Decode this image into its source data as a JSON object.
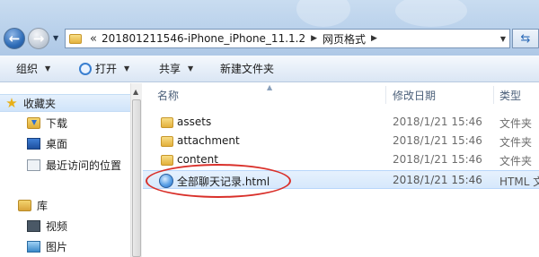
{
  "address_bar": {
    "overflow_marker": "«",
    "segments": [
      "201801211546-iPhone_iPhone_11.1.2",
      "网页格式"
    ]
  },
  "toolbar": {
    "organize_label": "组织",
    "open_label": "打开",
    "share_label": "共享",
    "new_folder_label": "新建文件夹"
  },
  "navigation": {
    "favorites_label": "收藏夹",
    "favorites_items": [
      "下载",
      "桌面",
      "最近访问的位置"
    ],
    "library_label": "库",
    "library_items": [
      "视频",
      "图片"
    ]
  },
  "columns": {
    "name": "名称",
    "date_modified": "修改日期",
    "type": "类型"
  },
  "files": [
    {
      "name": "assets",
      "date": "2018/1/21 15:46",
      "type": "文件夹",
      "icon": "folder-icon"
    },
    {
      "name": "attachment",
      "date": "2018/1/21 15:46",
      "type": "文件夹",
      "icon": "folder-icon"
    },
    {
      "name": "content",
      "date": "2018/1/21 15:46",
      "type": "文件夹",
      "icon": "folder-icon"
    },
    {
      "name": "全部聊天记录.html",
      "date": "2018/1/21 15:46",
      "type": "HTML 文档",
      "icon": "html-file-icon",
      "selected": true
    }
  ],
  "colors": {
    "highlight_circle": "#d9302a",
    "selection": "#d6e8fc"
  }
}
